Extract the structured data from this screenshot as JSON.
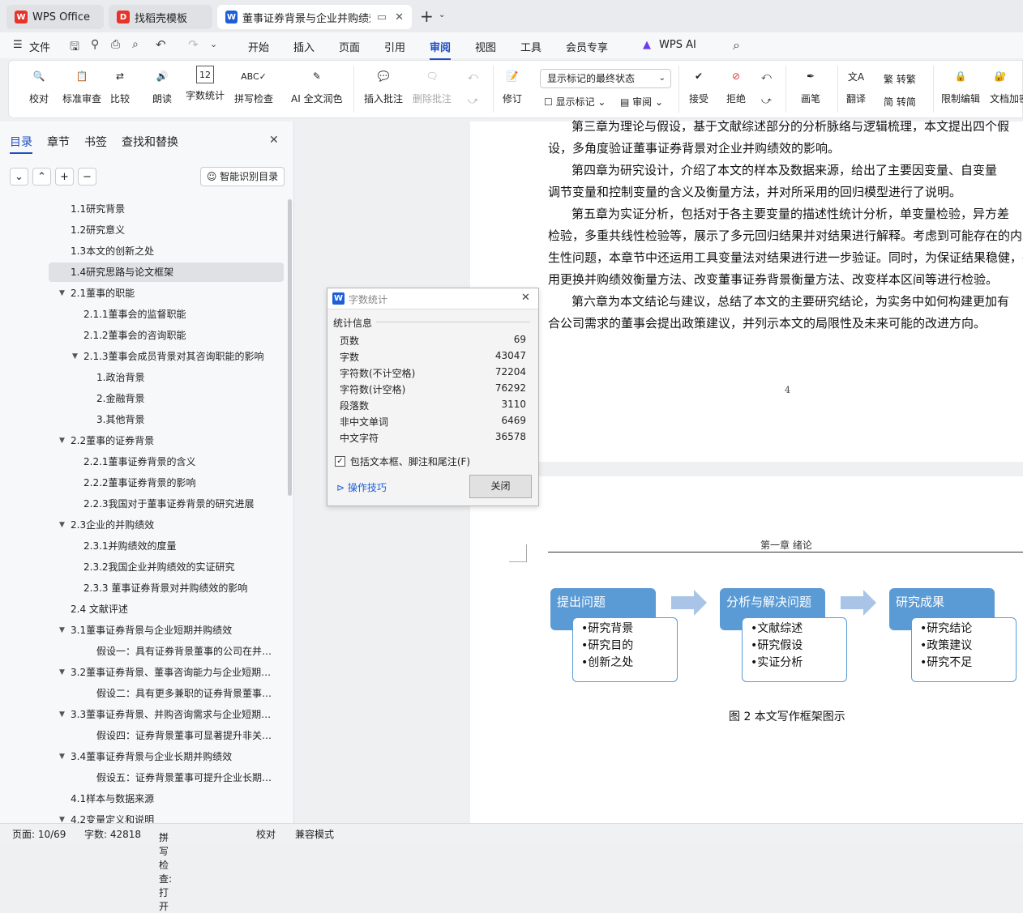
{
  "tabs": [
    {
      "label": "WPS Office",
      "logo": "W"
    },
    {
      "label": "找稻壳模板",
      "logo": "D"
    },
    {
      "label": "董事证券背景与企业并购绩效",
      "logo": "W"
    }
  ],
  "menu": {
    "file": "文件",
    "items": [
      "开始",
      "插入",
      "页面",
      "引用",
      "审阅",
      "视图",
      "工具",
      "会员专享",
      "WPS AI"
    ],
    "active": "审阅"
  },
  "ribbon": {
    "proof": "校对",
    "standard_review": "标准审查",
    "compare": "比较",
    "read": "朗读",
    "word_count": "字数统计",
    "spell_check": "拼写检查",
    "ai_polish": "AI 全文润色",
    "insert_comment": "插入批注",
    "delete_comment": "删除批注",
    "track": "修订",
    "markup_select": "显示标记的最终状态",
    "show_markup": "显示标记",
    "review": "审阅",
    "accept": "接受",
    "reject": "拒绝",
    "pen": "画笔",
    "translate": "翻译",
    "to_traditional": "转繁",
    "to_simplified": "转简",
    "restrict_edit": "限制编辑",
    "doc_encrypt": "文档加密"
  },
  "sidebar": {
    "tabs": [
      "目录",
      "章节",
      "书签",
      "查找和替换"
    ],
    "smart_toc": "智能识别目录",
    "toc": [
      {
        "label": "1.1研究背景",
        "level": 1,
        "caret": false
      },
      {
        "label": "1.2研究意义",
        "level": 1,
        "caret": false
      },
      {
        "label": "1.3本文的创新之处",
        "level": 1,
        "caret": false
      },
      {
        "label": "1.4研究思路与论文框架",
        "level": 1,
        "caret": false,
        "selected": true
      },
      {
        "label": "2.1董事的职能",
        "level": 1,
        "caret": true
      },
      {
        "label": "2.1.1董事会的监督职能",
        "level": 2,
        "caret": false
      },
      {
        "label": "2.1.2董事会的咨询职能",
        "level": 2,
        "caret": false
      },
      {
        "label": "2.1.3董事会成员背景对其咨询职能的影响",
        "level": 2,
        "caret": true
      },
      {
        "label": "1.政治背景",
        "level": 3,
        "caret": false
      },
      {
        "label": "2.金融背景",
        "level": 3,
        "caret": false
      },
      {
        "label": "3.其他背景",
        "level": 3,
        "caret": false
      },
      {
        "label": "2.2董事的证券背景",
        "level": 1,
        "caret": true
      },
      {
        "label": "2.2.1董事证券背景的含义",
        "level": 2,
        "caret": false
      },
      {
        "label": "2.2.2董事证券背景的影响",
        "level": 2,
        "caret": false
      },
      {
        "label": "2.2.3我国对于董事证券背景的研究进展",
        "level": 2,
        "caret": false
      },
      {
        "label": "2.3企业的并购绩效",
        "level": 1,
        "caret": true
      },
      {
        "label": "2.3.1并购绩效的度量",
        "level": 2,
        "caret": false
      },
      {
        "label": "2.3.2我国企业并购绩效的实证研究",
        "level": 2,
        "caret": false
      },
      {
        "label": "2.3.3 董事证券背景对并购绩效的影响",
        "level": 2,
        "caret": false
      },
      {
        "label": "2.4 文献评述",
        "level": 1,
        "caret": false
      },
      {
        "label": "3.1董事证券背景与企业短期并购绩效",
        "level": 1,
        "caret": true
      },
      {
        "label": "假设一：具有证券背景董事的公司在并购中…",
        "level": 3,
        "caret": false
      },
      {
        "label": "3.2董事证券背景、董事咨询能力与企业短期…",
        "level": 1,
        "caret": true
      },
      {
        "label": "假设二：具有更多兼职的证券背景董事…",
        "level": 3,
        "caret": false
      },
      {
        "label": "3.3董事证券背景、并购咨询需求与企业短期…",
        "level": 1,
        "caret": true
      },
      {
        "label": "假设四：证券背景董事可显著提升非关联…",
        "level": 3,
        "caret": false
      },
      {
        "label": "3.4董事证券背景与企业长期并购绩效",
        "level": 1,
        "caret": true
      },
      {
        "label": "假设五：证券背景董事可提升企业长期…",
        "level": 3,
        "caret": false
      },
      {
        "label": "4.1样本与数据来源",
        "level": 1,
        "caret": false
      },
      {
        "label": "4.2变量定义和说明",
        "level": 1,
        "caret": true
      }
    ]
  },
  "document": {
    "paragraphs": [
      "第三章为理论与假设，基于文献综述部分的分析脉络与逻辑梳理，本文提出四个假",
      "设，多角度验证董事证券背景对企业并购绩效的影响。",
      "第四章为研究设计，介绍了本文的样本及数据来源，给出了主要因变量、自变量",
      "调节变量和控制变量的含义及衡量方法，并对所采用的回归模型进行了说明。",
      "第五章为实证分析，包括对于各主要变量的描述性统计分析，单变量检验，异方差",
      "检验，多重共线性检验等，展示了多元回归结果并对结果进行解释。考虑到可能存在的内",
      "生性问题，本章节中还运用工具变量法对结果进行进一步验证。同时，为保证结果稳健，并",
      "用更换并购绩效衡量方法、改变董事证券背景衡量方法、改变样本区间等进行检验。",
      "第六章为本文结论与建议，总结了本文的主要研究结论，为实务中如何构建更加有",
      "合公司需求的董事会提出政策建议，并列示本文的局限性及未来可能的改进方向。"
    ],
    "page_number": "4",
    "header": "第一章  绪论",
    "framework": [
      {
        "title": "提出问题",
        "items": [
          "•研究背景",
          "•研究目的",
          "•创新之处"
        ]
      },
      {
        "title": "分析与解决问题",
        "items": [
          "•文献综述",
          "•研究假设",
          "•实证分析"
        ]
      },
      {
        "title": "研究成果",
        "items": [
          "•研究结论",
          "•政策建议",
          "•研究不足"
        ]
      }
    ],
    "caption": "图 2  本文写作框架图示"
  },
  "dialog": {
    "title": "字数统计",
    "section": "统计信息",
    "rows": [
      {
        "label": "页数",
        "value": "69"
      },
      {
        "label": "字数",
        "value": "43047"
      },
      {
        "label": "字符数(不计空格)",
        "value": "72204"
      },
      {
        "label": "字符数(计空格)",
        "value": "76292"
      },
      {
        "label": "段落数",
        "value": "3110"
      },
      {
        "label": "非中文单词",
        "value": "6469"
      },
      {
        "label": "中文字符",
        "value": "36578"
      }
    ],
    "checkbox": "包括文本框、脚注和尾注(F)",
    "tips": "操作技巧",
    "close": "关闭"
  },
  "status": {
    "page": "页面: 10/69",
    "words": "字数: 42818",
    "spell": "拼写检查: 打开",
    "proof": "校对",
    "mode": "兼容模式"
  },
  "colors": {
    "accent": "#1e4fc2",
    "wps_red": "#e8322a",
    "diagram_blue": "#5b9bd5"
  }
}
